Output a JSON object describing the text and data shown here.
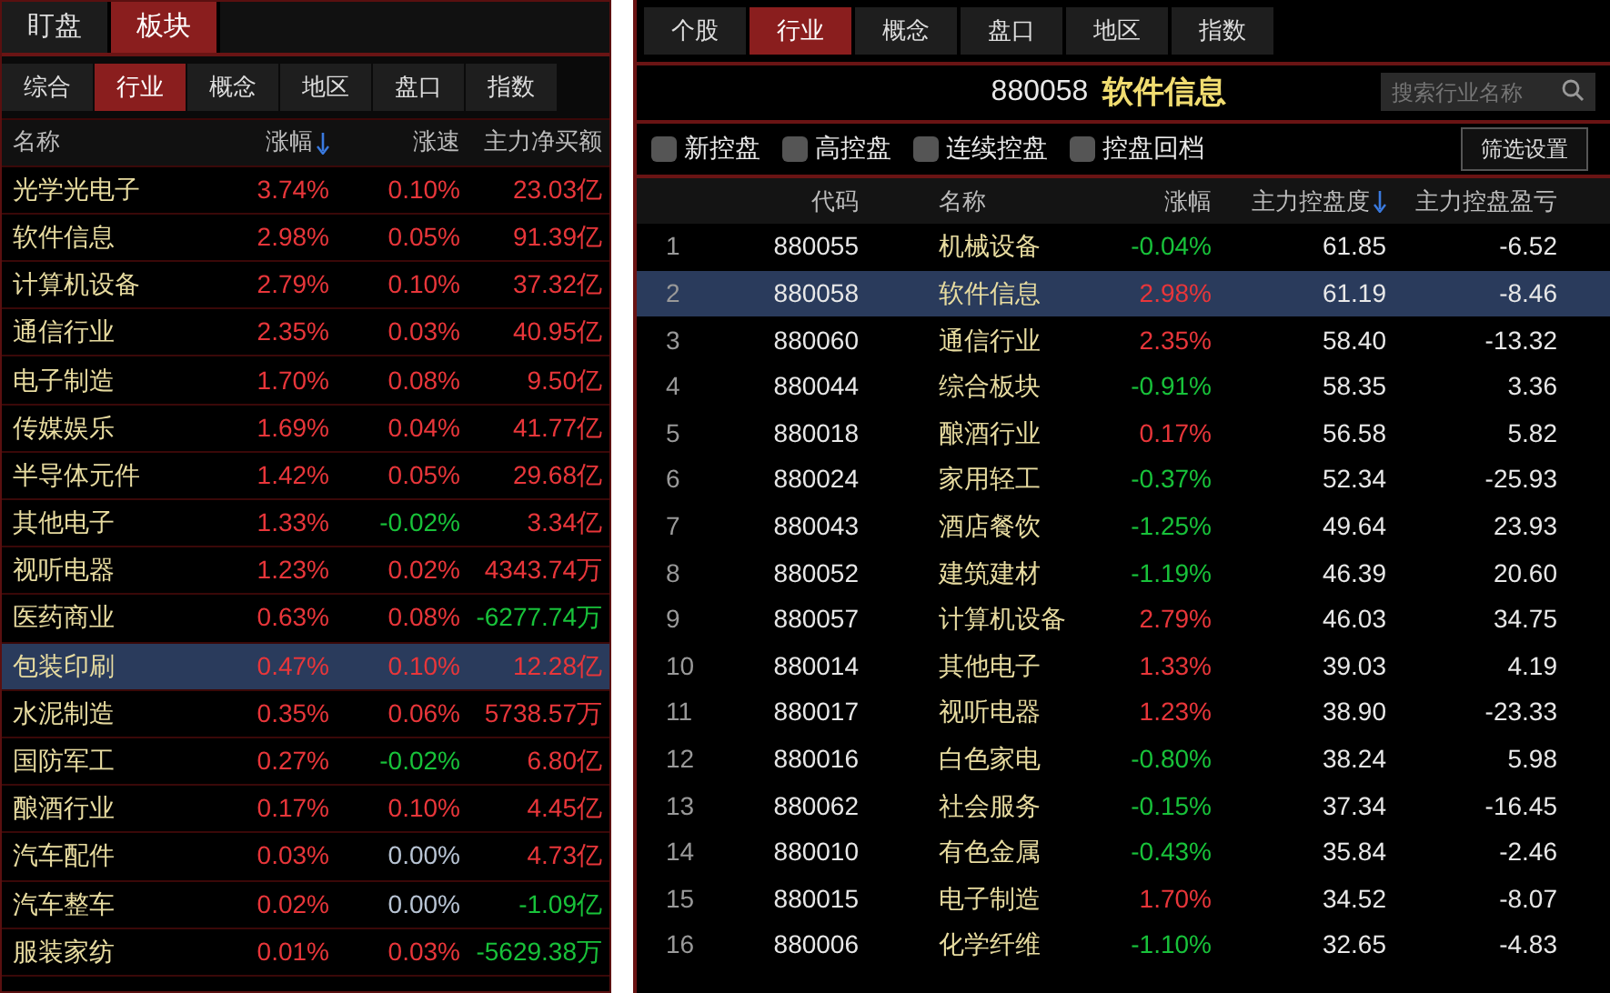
{
  "left_panel": {
    "top_tabs": [
      {
        "label": "盯盘",
        "selected": false
      },
      {
        "label": "板块",
        "selected": true
      }
    ],
    "sub_tabs": [
      {
        "label": "综合",
        "selected": false
      },
      {
        "label": "行业",
        "selected": true
      },
      {
        "label": "概念",
        "selected": false
      },
      {
        "label": "地区",
        "selected": false
      },
      {
        "label": "盘口",
        "selected": false
      },
      {
        "label": "指数",
        "selected": false
      }
    ],
    "columns": [
      {
        "label": "名称",
        "sorted": false
      },
      {
        "label": "涨幅",
        "sorted": true
      },
      {
        "label": "涨速",
        "sorted": false
      },
      {
        "label": "主力净买额",
        "sorted": false
      }
    ],
    "rows": [
      {
        "name": "光学光电子",
        "change": {
          "text": "3.74%",
          "color": "#e8363a"
        },
        "speed": {
          "text": "0.10%",
          "color": "#e8363a"
        },
        "flow": {
          "text": "23.03亿",
          "color": "#e8363a"
        },
        "selected": false
      },
      {
        "name": "软件信息",
        "change": {
          "text": "2.98%",
          "color": "#e8363a"
        },
        "speed": {
          "text": "0.05%",
          "color": "#e8363a"
        },
        "flow": {
          "text": "91.39亿",
          "color": "#e8363a"
        },
        "selected": false
      },
      {
        "name": "计算机设备",
        "change": {
          "text": "2.79%",
          "color": "#e8363a"
        },
        "speed": {
          "text": "0.10%",
          "color": "#e8363a"
        },
        "flow": {
          "text": "37.32亿",
          "color": "#e8363a"
        },
        "selected": false
      },
      {
        "name": "通信行业",
        "change": {
          "text": "2.35%",
          "color": "#e8363a"
        },
        "speed": {
          "text": "0.03%",
          "color": "#e8363a"
        },
        "flow": {
          "text": "40.95亿",
          "color": "#e8363a"
        },
        "selected": false
      },
      {
        "name": "电子制造",
        "change": {
          "text": "1.70%",
          "color": "#e8363a"
        },
        "speed": {
          "text": "0.08%",
          "color": "#e8363a"
        },
        "flow": {
          "text": "9.50亿",
          "color": "#e8363a"
        },
        "selected": false
      },
      {
        "name": "传媒娱乐",
        "change": {
          "text": "1.69%",
          "color": "#e8363a"
        },
        "speed": {
          "text": "0.04%",
          "color": "#e8363a"
        },
        "flow": {
          "text": "41.77亿",
          "color": "#e8363a"
        },
        "selected": false
      },
      {
        "name": "半导体元件",
        "change": {
          "text": "1.42%",
          "color": "#e8363a"
        },
        "speed": {
          "text": "0.05%",
          "color": "#e8363a"
        },
        "flow": {
          "text": "29.68亿",
          "color": "#e8363a"
        },
        "selected": false
      },
      {
        "name": "其他电子",
        "change": {
          "text": "1.33%",
          "color": "#e8363a"
        },
        "speed": {
          "text": "-0.02%",
          "color": "#18c23a"
        },
        "flow": {
          "text": "3.34亿",
          "color": "#e8363a"
        },
        "selected": false
      },
      {
        "name": "视听电器",
        "change": {
          "text": "1.23%",
          "color": "#e8363a"
        },
        "speed": {
          "text": "0.02%",
          "color": "#e8363a"
        },
        "flow": {
          "text": "4343.74万",
          "color": "#e8363a"
        },
        "selected": false
      },
      {
        "name": "医药商业",
        "change": {
          "text": "0.63%",
          "color": "#e8363a"
        },
        "speed": {
          "text": "0.08%",
          "color": "#e8363a"
        },
        "flow": {
          "text": "-6277.74万",
          "color": "#18c23a"
        },
        "selected": false
      },
      {
        "name": "包装印刷",
        "change": {
          "text": "0.47%",
          "color": "#e8363a"
        },
        "speed": {
          "text": "0.10%",
          "color": "#e8363a"
        },
        "flow": {
          "text": "12.28亿",
          "color": "#e8363a"
        },
        "selected": true
      },
      {
        "name": "水泥制造",
        "change": {
          "text": "0.35%",
          "color": "#e8363a"
        },
        "speed": {
          "text": "0.06%",
          "color": "#e8363a"
        },
        "flow": {
          "text": "5738.57万",
          "color": "#e8363a"
        },
        "selected": false
      },
      {
        "name": "国防军工",
        "change": {
          "text": "0.27%",
          "color": "#e8363a"
        },
        "speed": {
          "text": "-0.02%",
          "color": "#18c23a"
        },
        "flow": {
          "text": "6.80亿",
          "color": "#e8363a"
        },
        "selected": false
      },
      {
        "name": "酿酒行业",
        "change": {
          "text": "0.17%",
          "color": "#e8363a"
        },
        "speed": {
          "text": "0.10%",
          "color": "#e8363a"
        },
        "flow": {
          "text": "4.45亿",
          "color": "#e8363a"
        },
        "selected": false
      },
      {
        "name": "汽车配件",
        "change": {
          "text": "0.03%",
          "color": "#e8363a"
        },
        "speed": {
          "text": "0.00%",
          "color": "#b8c4d4"
        },
        "flow": {
          "text": "4.73亿",
          "color": "#e8363a"
        },
        "selected": false
      },
      {
        "name": "汽车整车",
        "change": {
          "text": "0.02%",
          "color": "#e8363a"
        },
        "speed": {
          "text": "0.00%",
          "color": "#b8c4d4"
        },
        "flow": {
          "text": "-1.09亿",
          "color": "#18c23a"
        },
        "selected": false
      },
      {
        "name": "服装家纺",
        "change": {
          "text": "0.01%",
          "color": "#e8363a"
        },
        "speed": {
          "text": "0.03%",
          "color": "#e8363a"
        },
        "flow": {
          "text": "-5629.38万",
          "color": "#18c23a"
        },
        "selected": false
      }
    ]
  },
  "right_panel": {
    "tabs": [
      {
        "label": "个股",
        "selected": false
      },
      {
        "label": "行业",
        "selected": true
      },
      {
        "label": "概念",
        "selected": false
      },
      {
        "label": "盘口",
        "selected": false
      },
      {
        "label": "地区",
        "selected": false
      },
      {
        "label": "指数",
        "selected": false
      }
    ],
    "title_code": "880058",
    "title_name": "软件信息",
    "search": {
      "placeholder": "搜索行业名称"
    },
    "filters": [
      {
        "label": "新控盘",
        "checked": false
      },
      {
        "label": "高控盘",
        "checked": false
      },
      {
        "label": "连续控盘",
        "checked": false
      },
      {
        "label": "控盘回档",
        "checked": false
      }
    ],
    "filter_button": "筛选设置",
    "columns": [
      {
        "label": "代码",
        "sorted": false
      },
      {
        "label": "名称",
        "sorted": false
      },
      {
        "label": "涨幅",
        "sorted": false
      },
      {
        "label": "主力控盘度",
        "sorted": true
      },
      {
        "label": "主力控盘盈亏",
        "sorted": false
      }
    ],
    "rows": [
      {
        "rank": "1",
        "code": "880055",
        "name": "机械设备",
        "change": {
          "text": "-0.04%",
          "color": "#18c23a"
        },
        "control": "61.85",
        "profit": "-6.52",
        "selected": false
      },
      {
        "rank": "2",
        "code": "880058",
        "name": "软件信息",
        "change": {
          "text": "2.98%",
          "color": "#e8363a"
        },
        "control": "61.19",
        "profit": "-8.46",
        "selected": true
      },
      {
        "rank": "3",
        "code": "880060",
        "name": "通信行业",
        "change": {
          "text": "2.35%",
          "color": "#e8363a"
        },
        "control": "58.40",
        "profit": "-13.32",
        "selected": false
      },
      {
        "rank": "4",
        "code": "880044",
        "name": "综合板块",
        "change": {
          "text": "-0.91%",
          "color": "#18c23a"
        },
        "control": "58.35",
        "profit": "3.36",
        "selected": false
      },
      {
        "rank": "5",
        "code": "880018",
        "name": "酿酒行业",
        "change": {
          "text": "0.17%",
          "color": "#e8363a"
        },
        "control": "56.58",
        "profit": "5.82",
        "selected": false
      },
      {
        "rank": "6",
        "code": "880024",
        "name": "家用轻工",
        "change": {
          "text": "-0.37%",
          "color": "#18c23a"
        },
        "control": "52.34",
        "profit": "-25.93",
        "selected": false
      },
      {
        "rank": "7",
        "code": "880043",
        "name": "酒店餐饮",
        "change": {
          "text": "-1.25%",
          "color": "#18c23a"
        },
        "control": "49.64",
        "profit": "23.93",
        "selected": false
      },
      {
        "rank": "8",
        "code": "880052",
        "name": "建筑建材",
        "change": {
          "text": "-1.19%",
          "color": "#18c23a"
        },
        "control": "46.39",
        "profit": "20.60",
        "selected": false
      },
      {
        "rank": "9",
        "code": "880057",
        "name": "计算机设备",
        "change": {
          "text": "2.79%",
          "color": "#e8363a"
        },
        "control": "46.03",
        "profit": "34.75",
        "selected": false
      },
      {
        "rank": "10",
        "code": "880014",
        "name": "其他电子",
        "change": {
          "text": "1.33%",
          "color": "#e8363a"
        },
        "control": "39.03",
        "profit": "4.19",
        "selected": false
      },
      {
        "rank": "11",
        "code": "880017",
        "name": "视听电器",
        "change": {
          "text": "1.23%",
          "color": "#e8363a"
        },
        "control": "38.90",
        "profit": "-23.33",
        "selected": false
      },
      {
        "rank": "12",
        "code": "880016",
        "name": "白色家电",
        "change": {
          "text": "-0.80%",
          "color": "#18c23a"
        },
        "control": "38.24",
        "profit": "5.98",
        "selected": false
      },
      {
        "rank": "13",
        "code": "880062",
        "name": "社会服务",
        "change": {
          "text": "-0.15%",
          "color": "#18c23a"
        },
        "control": "37.34",
        "profit": "-16.45",
        "selected": false
      },
      {
        "rank": "14",
        "code": "880010",
        "name": "有色金属",
        "change": {
          "text": "-0.43%",
          "color": "#18c23a"
        },
        "control": "35.84",
        "profit": "-2.46",
        "selected": false
      },
      {
        "rank": "15",
        "code": "880015",
        "name": "电子制造",
        "change": {
          "text": "1.70%",
          "color": "#e8363a"
        },
        "control": "34.52",
        "profit": "-8.07",
        "selected": false
      },
      {
        "rank": "16",
        "code": "880006",
        "name": "化学纤维",
        "change": {
          "text": "-1.10%",
          "color": "#18c23a"
        },
        "control": "32.65",
        "profit": "-4.83",
        "selected": false
      }
    ]
  }
}
